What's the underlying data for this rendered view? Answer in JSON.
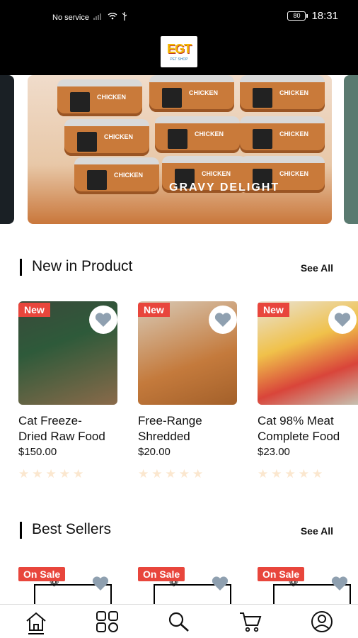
{
  "status_bar": {
    "network": "No service",
    "battery": "80",
    "time": "18:31"
  },
  "header": {
    "logo_text": "EGT",
    "logo_sub": "PET SHOP"
  },
  "banner": {
    "can_label": "CHICKEN",
    "caption": "GRAVY DELIGHT"
  },
  "sections": {
    "new": {
      "title": "New in Product",
      "see_all": "See All"
    },
    "best": {
      "title": "Best Sellers",
      "see_all": "See All"
    }
  },
  "products": [
    {
      "badge": "New",
      "name_line1": "Cat Freeze-",
      "name_line2": "Dried Raw Food",
      "price": "$150.00",
      "rating": 0
    },
    {
      "badge": "New",
      "name_line1": "Free-Range",
      "name_line2": "Shredded",
      "price": "$20.00",
      "rating": 0
    },
    {
      "badge": "New",
      "name_line1": "Cat 98% Meat",
      "name_line2": "Complete Food",
      "price": "$23.00",
      "rating": 0
    }
  ],
  "best_sellers": [
    {
      "badge": "On Sale"
    },
    {
      "badge": "On Sale"
    },
    {
      "badge": "On Sale"
    }
  ],
  "nav": {
    "items": [
      "home-icon",
      "categories-icon",
      "search-icon",
      "cart-icon",
      "profile-icon"
    ]
  },
  "colors": {
    "accent": "#e8463c",
    "star_empty": "#fbe7cf",
    "heart": "#8fa0b0"
  }
}
